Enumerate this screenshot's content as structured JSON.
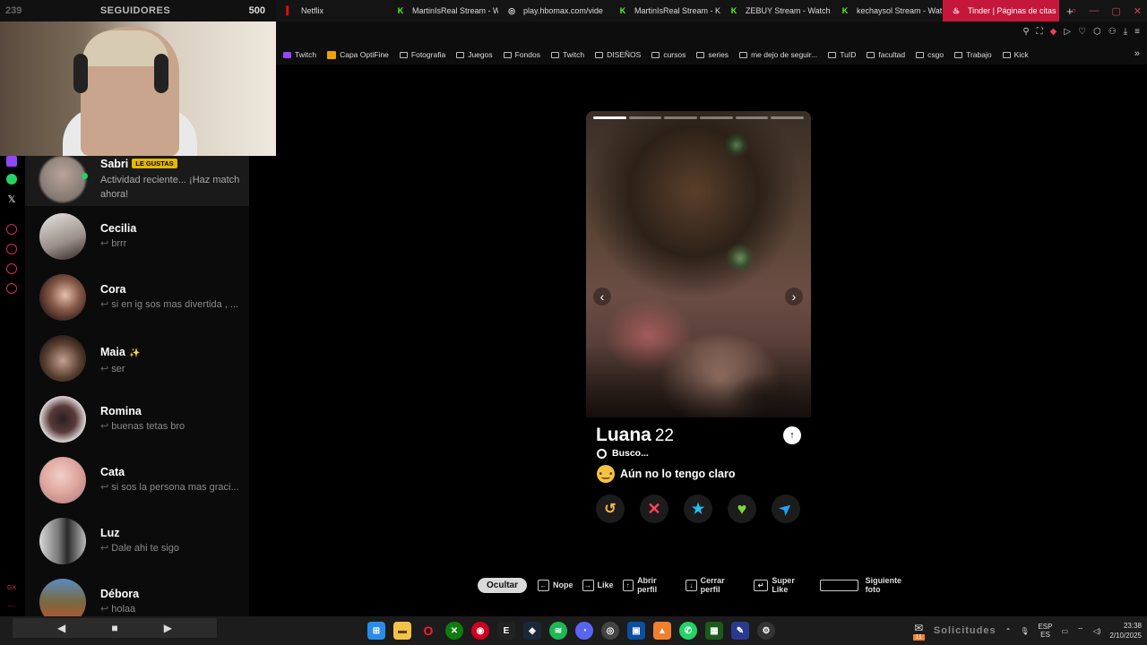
{
  "overlay": {
    "follow_count_left": "239",
    "follow_label": "SEGUIDORES",
    "follow_count_right": "500"
  },
  "browser": {
    "tabs": [
      {
        "label": "Netflix",
        "icon": "netflix-icon",
        "color": "#e50914"
      },
      {
        "label": "MartinIsReal Stream - W",
        "icon": "kick-icon",
        "color": "#53fc18"
      },
      {
        "label": "play.hbomax.com/vide",
        "icon": "globe-icon",
        "color": "#dddddd"
      },
      {
        "label": "MartinIsReal Stream - K",
        "icon": "kick-icon",
        "color": "#53fc18"
      },
      {
        "label": "ZEBUY Stream - Watch",
        "icon": "kick-icon",
        "color": "#53fc18"
      },
      {
        "label": "kechaysol Stream - Wat",
        "icon": "kick-icon",
        "color": "#53fc18"
      },
      {
        "label": "Tinder | Páginas de citas",
        "icon": "tinder-flame-icon",
        "color": "#ffffff",
        "active": true
      }
    ],
    "new_tab": "+",
    "bookmarks": [
      {
        "label": "Twitch",
        "icon": "twitch"
      },
      {
        "label": "Capa OptiFine",
        "icon": "df"
      },
      {
        "label": "Fotografia",
        "icon": "folder"
      },
      {
        "label": "Juegos",
        "icon": "folder"
      },
      {
        "label": "Fondos",
        "icon": "folder"
      },
      {
        "label": "Twitch",
        "icon": "folder"
      },
      {
        "label": "DISEÑOS",
        "icon": "folder"
      },
      {
        "label": "cursos",
        "icon": "folder"
      },
      {
        "label": "series",
        "icon": "folder"
      },
      {
        "label": "me dejo de seguir...",
        "icon": "folder"
      },
      {
        "label": "TuID",
        "icon": "folder"
      },
      {
        "label": "facultad",
        "icon": "folder"
      },
      {
        "label": "csgo",
        "icon": "folder"
      },
      {
        "label": "Trabajo",
        "icon": "folder"
      },
      {
        "label": "Kick",
        "icon": "folder"
      }
    ]
  },
  "matches": [
    {
      "name": "Sabri",
      "badge": "LE GUSTAS",
      "message": "Actividad reciente... ¡Haz match ahora!",
      "online": true
    },
    {
      "name": "Cecilia",
      "message": "brrr"
    },
    {
      "name": "Cora",
      "message": "si en ig sos mas divertida , ..."
    },
    {
      "name": "Maia",
      "emoji": "✨",
      "message": "ser"
    },
    {
      "name": "Romina",
      "message": "buenas tetas bro"
    },
    {
      "name": "Cata",
      "message": "si sos la persona mas graci..."
    },
    {
      "name": "Luz",
      "message": "Dale ahi te sigo"
    },
    {
      "name": "Débora",
      "message": "holaa"
    }
  ],
  "profile": {
    "name": "Luana",
    "age": "22",
    "looking_label": "Busco...",
    "intent": "Aún no lo tengo claro",
    "photo_count": 6,
    "current_photo": 1
  },
  "actions": {
    "rewind_icon": "↺",
    "nope_icon": "✕",
    "superlike_icon": "★",
    "like_icon": "♥",
    "boost_icon": "➤"
  },
  "shortcuts": {
    "hide": "Ocultar",
    "nope": "Nope",
    "like": "Like",
    "open_profile": "Abrir perfil",
    "close_profile": "Cerrar perfil",
    "super_like": "Super Like",
    "next_photo": "Siguiente foto"
  },
  "taskbar": {
    "notifications": "Solicitudes",
    "lang_top": "ESP",
    "lang_bottom": "ES",
    "time": "23:38",
    "date": "2/10/2025",
    "mail_badge": "11"
  },
  "colors": {
    "accent": "#c5173c",
    "nope": "#ff4458",
    "superlike": "#1ec1f3",
    "like": "#7ad93b",
    "rewind": "#f5b748",
    "boost": "#21a3f7"
  }
}
